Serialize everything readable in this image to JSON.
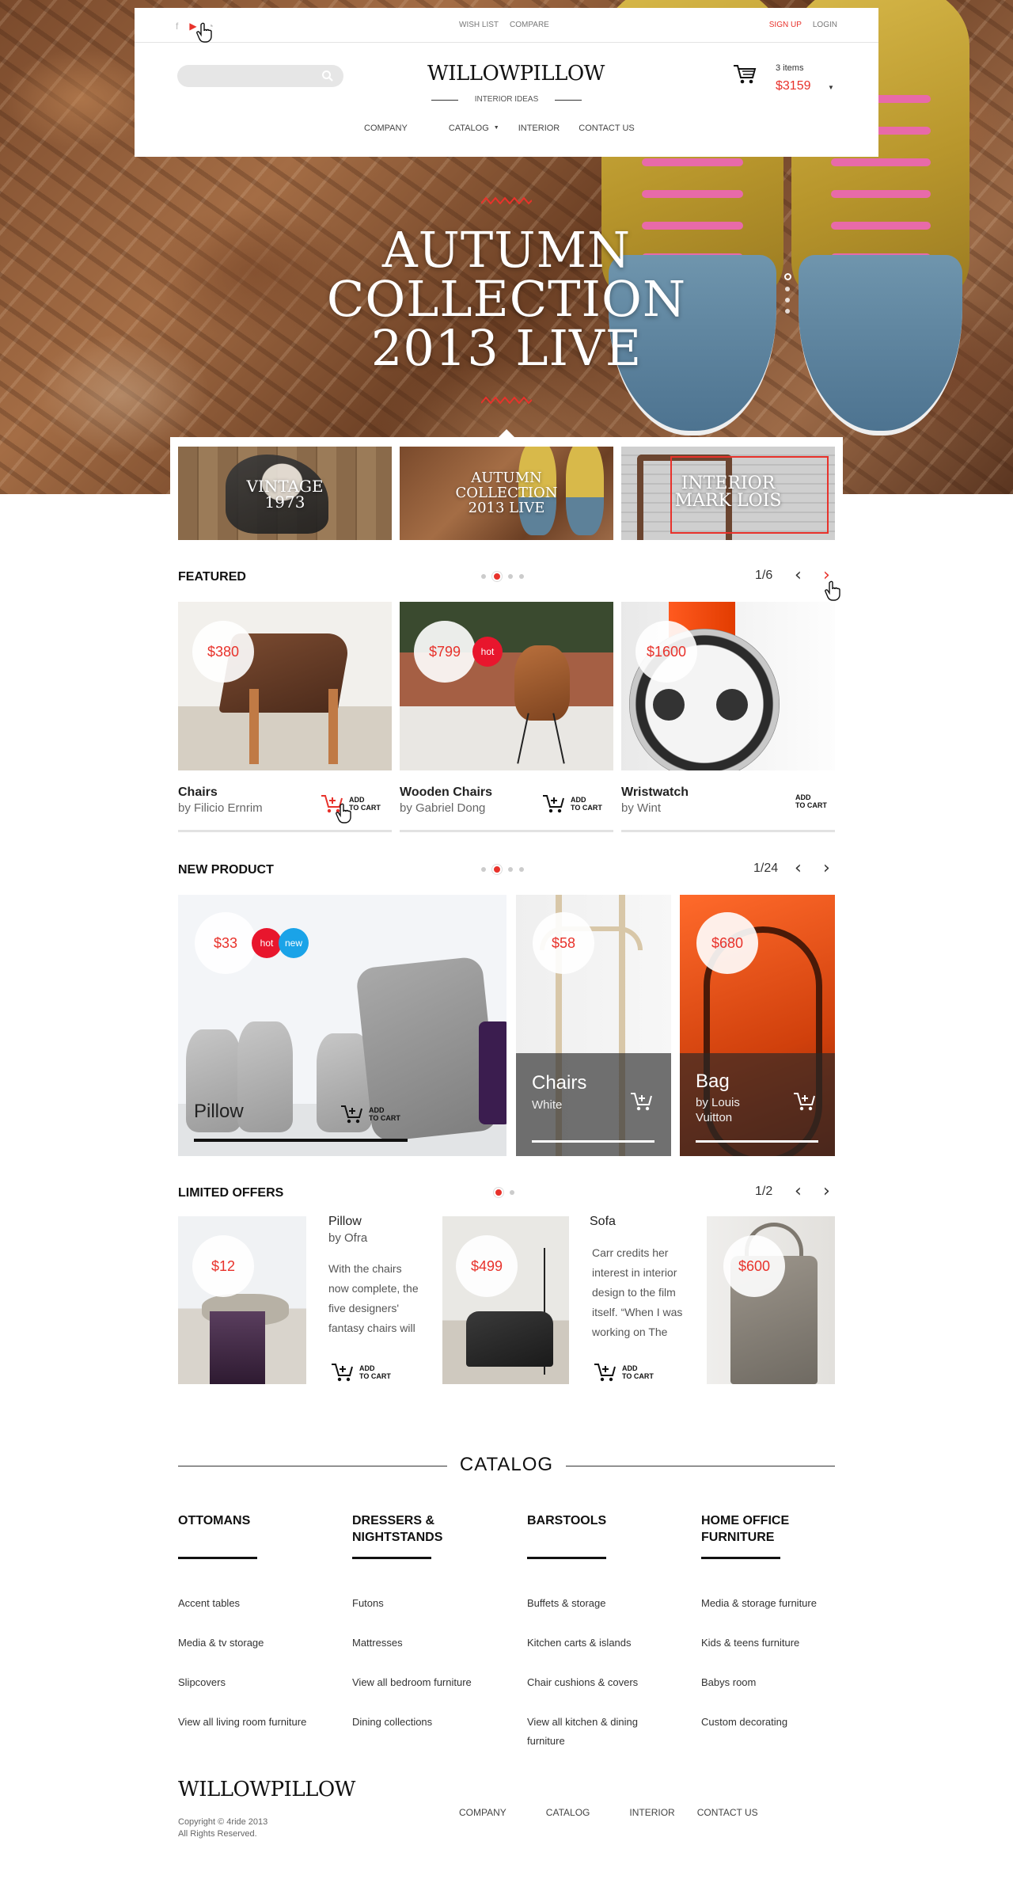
{
  "header": {
    "toplinks": [
      "WISH LIST",
      "COMPARE"
    ],
    "signup": "SIGN UP",
    "login": "LOGIN",
    "search_placeholder": "",
    "logo": "WILLOWPILLOW",
    "tagline": "INTERIOR IDEAS",
    "cart_items": "3 items",
    "cart_total": "$3159",
    "nav": [
      "COMPANY",
      "CATALOG",
      "INTERIOR",
      "CONTACT US"
    ]
  },
  "hero": {
    "title_lines": [
      "AUTUMN",
      "COLLECTION",
      "2013 LIVE"
    ]
  },
  "promos": [
    {
      "lines": [
        "VINTAGE",
        "1973"
      ]
    },
    {
      "lines": [
        "AUTUMN",
        "COLLECTION",
        "2013 LIVE"
      ]
    },
    {
      "lines": [
        "INTERIOR",
        "MARK LOIS"
      ]
    }
  ],
  "featured": {
    "title": "FEATURED",
    "pager": "1/6",
    "items": [
      {
        "price": "$380",
        "name": "Chairs",
        "by": "by Filicio Ernrim",
        "badge": ""
      },
      {
        "price": "$799",
        "name": "Wooden Chairs",
        "by": "by Gabriel Dong",
        "badge": "hot"
      },
      {
        "price": "$1600",
        "name": "Wristwatch",
        "by": "by Wint",
        "badge": ""
      }
    ]
  },
  "add_to_cart": [
    "ADD",
    "TO CART"
  ],
  "new_product": {
    "title": "NEW PRODUCT",
    "pager": "1/24",
    "items": [
      {
        "price": "$33",
        "name": "Pillow",
        "sub": "",
        "badges": [
          "hot",
          "new"
        ]
      },
      {
        "price": "$58",
        "name": "Chairs",
        "sub": "White"
      },
      {
        "price": "$680",
        "name": "Bag",
        "sub": "by Louis Vuitton"
      }
    ]
  },
  "limited": {
    "title": "LIMITED OFFERS",
    "pager": "1/2",
    "items": [
      {
        "price": "$12",
        "name": "Pillow",
        "by": "by Ofra",
        "desc": "With the chairs now complete, the five designers' fantasy chairs will"
      },
      {
        "price": "$499",
        "name": "Sofa",
        "by": "",
        "desc": "Carr credits her interest in interior design to the film itself. “When I was working on The"
      },
      {
        "price": "$600"
      }
    ]
  },
  "catalog": {
    "title": "CATALOG",
    "columns": [
      {
        "head": "OTTOMANS",
        "links": [
          "Accent tables",
          "Media & tv storage",
          "Slipcovers",
          "View all living room furniture"
        ]
      },
      {
        "head": "DRESSERS & NIGHTSTANDS",
        "links": [
          "Futons",
          "Mattresses",
          "View all bedroom furniture",
          "Dining collections"
        ]
      },
      {
        "head": "BARSTOOLS",
        "links": [
          "Buffets & storage",
          "Kitchen carts & islands",
          "Chair cushions & covers",
          "View all kitchen & dining furniture"
        ]
      },
      {
        "head": "HOME OFFICE FURNITURE",
        "links": [
          "Media & storage furniture",
          "Kids & teens furniture",
          "Babys room",
          "Custom decorating"
        ]
      }
    ]
  },
  "footer": {
    "logo": "WILLOWPILLOW",
    "copyright": "Copyright © 4ride 2013",
    "rights": "All Rights Reserved.",
    "nav": [
      "COMPANY",
      "CATALOG",
      "INTERIOR",
      "CONTACT US"
    ]
  },
  "colors": {
    "accent": "#e8322b",
    "hot": "#e8162d",
    "new": "#1aa3e8"
  },
  "icons": [
    "facebook-icon",
    "youtube-icon",
    "rss-icon",
    "search-icon",
    "cart-icon",
    "chevron-left-icon",
    "chevron-right-icon",
    "hand-cursor-icon"
  ]
}
